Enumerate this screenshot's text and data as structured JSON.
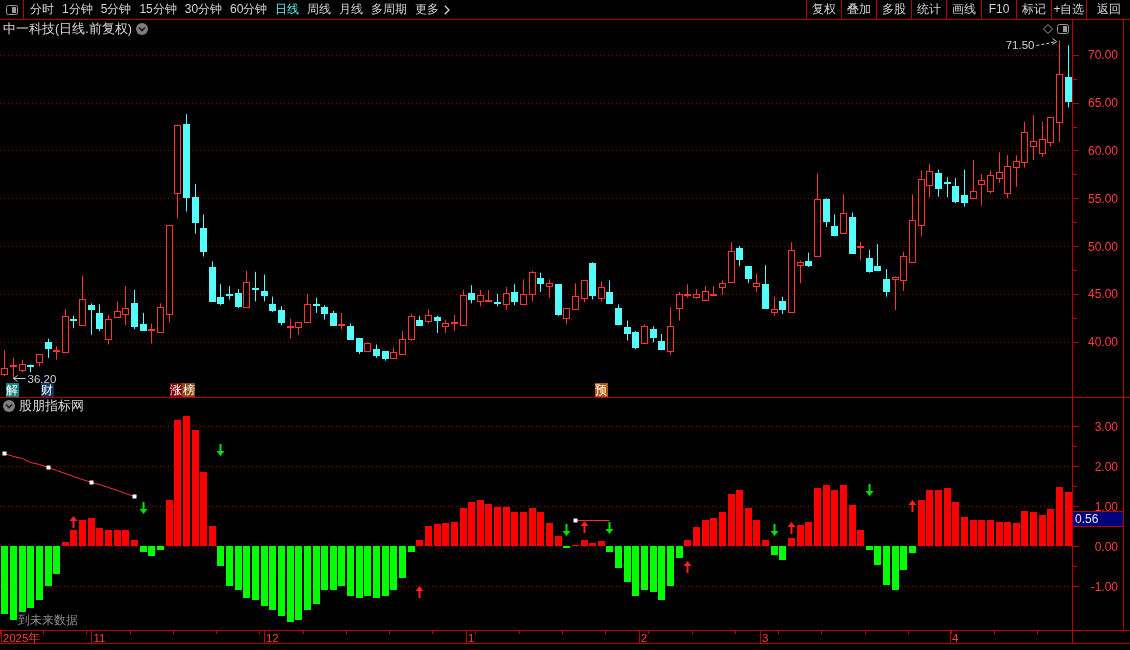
{
  "toolbar": {
    "periods": [
      {
        "label": "分时",
        "selected": false
      },
      {
        "label": "1分钟",
        "selected": false
      },
      {
        "label": "5分钟",
        "selected": false
      },
      {
        "label": "15分钟",
        "selected": false
      },
      {
        "label": "30分钟",
        "selected": false
      },
      {
        "label": "60分钟",
        "selected": false
      },
      {
        "label": "日线",
        "selected": true
      },
      {
        "label": "周线",
        "selected": false
      },
      {
        "label": "月线",
        "selected": false
      },
      {
        "label": "多周期",
        "selected": false
      }
    ],
    "more": "更多",
    "buttons": [
      "复权",
      "叠加",
      "多股",
      "统计",
      "画线",
      "F10",
      "标记",
      "+自选",
      "返回"
    ]
  },
  "main_chart": {
    "title": "中一科技(日线.前复权)",
    "chart_data": [
      {
        "type": "candlestick",
        "tick_labels": "y",
        "ylim": [
          34.2,
          73.65
        ],
        "yticks": [
          {
            "value": 70,
            "label": "70.00"
          },
          {
            "value": 65,
            "label": "65.00"
          },
          {
            "value": 60,
            "label": "60.00"
          },
          {
            "value": 55,
            "label": "55.00"
          },
          {
            "value": 50,
            "label": "50.00"
          },
          {
            "value": 45,
            "label": "45.00"
          },
          {
            "value": 40,
            "label": "40.00"
          }
        ],
        "grid": true,
        "ohlc": [
          [
            36.6,
            39.1,
            36.4,
            37.2
          ],
          [
            37.4,
            38.3,
            36.2,
            37.5
          ],
          [
            37.0,
            38.1,
            36.8,
            37.7
          ],
          [
            37.5,
            37.6,
            36.8,
            37.4
          ],
          [
            37.9,
            38.7,
            37.4,
            38.7
          ],
          [
            40.0,
            40.3,
            38.3,
            39.3
          ],
          [
            39.0,
            39.5,
            38.1,
            39.1
          ],
          [
            38.9,
            43.4,
            38.9,
            42.7
          ],
          [
            42.4,
            42.7,
            41.4,
            42.3
          ],
          [
            41.7,
            46.9,
            41.7,
            44.5
          ],
          [
            43.8,
            44.0,
            40.7,
            43.4
          ],
          [
            43.0,
            43.9,
            41.1,
            41.4
          ],
          [
            40.3,
            42.8,
            39.7,
            42.4
          ],
          [
            42.6,
            44.2,
            42.5,
            43.2
          ],
          [
            42.9,
            45.8,
            41.7,
            43.5
          ],
          [
            44.0,
            45.4,
            41.3,
            41.6
          ],
          [
            41.8,
            43.0,
            41.1,
            41.2
          ],
          [
            41.2,
            41.9,
            39.8,
            41.3
          ],
          [
            41.0,
            44.0,
            41.0,
            43.6
          ],
          [
            42.9,
            52.2,
            42.0,
            52.2
          ],
          [
            55.5,
            62.7,
            52.9,
            62.7
          ],
          [
            62.75,
            63.8,
            53.6,
            55.1
          ],
          [
            55.1,
            56.5,
            51.3,
            52.5
          ],
          [
            51.9,
            53.3,
            48.9,
            49.5
          ],
          [
            47.8,
            48.4,
            44.2,
            44.2
          ],
          [
            44.7,
            46.0,
            43.8,
            44.0
          ],
          [
            45.0,
            45.8,
            44.4,
            44.9
          ],
          [
            45.1,
            45.5,
            43.5,
            43.7
          ],
          [
            43.6,
            47.4,
            43.5,
            46.2
          ],
          [
            45.6,
            47.3,
            44.2,
            45.5
          ],
          [
            45.3,
            47.0,
            44.2,
            44.9
          ],
          [
            43.9,
            44.7,
            43.1,
            43.3
          ],
          [
            43.3,
            43.7,
            41.7,
            42.1
          ],
          [
            41.5,
            42.4,
            40.3,
            41.6
          ],
          [
            41.5,
            42.0,
            40.7,
            42.0
          ],
          [
            42.0,
            45.0,
            42.0,
            43.9
          ],
          [
            43.9,
            44.6,
            43.0,
            43.8
          ],
          [
            43.6,
            43.8,
            42.3,
            43.0
          ],
          [
            43.0,
            43.2,
            41.7,
            41.7
          ],
          [
            41.7,
            43.0,
            41.3,
            41.8
          ],
          [
            41.6,
            41.9,
            40.2,
            40.3
          ],
          [
            40.4,
            40.4,
            38.7,
            39.0
          ],
          [
            39.0,
            39.9,
            39.0,
            39.9
          ],
          [
            39.2,
            39.7,
            38.3,
            38.6
          ],
          [
            39.0,
            39.0,
            38.0,
            38.3
          ],
          [
            38.3,
            39.4,
            38.3,
            38.9
          ],
          [
            38.7,
            41.1,
            38.7,
            40.3
          ],
          [
            40.3,
            42.9,
            40.1,
            42.7
          ],
          [
            42.3,
            42.7,
            41.7,
            41.7
          ],
          [
            42.2,
            43.4,
            41.9,
            42.8
          ],
          [
            42.6,
            42.7,
            40.9,
            42.3
          ],
          [
            41.6,
            42.3,
            40.9,
            41.9
          ],
          [
            41.9,
            42.8,
            41.1,
            42.0
          ],
          [
            41.7,
            45.4,
            41.7,
            44.9
          ],
          [
            45.1,
            45.9,
            44.0,
            44.5
          ],
          [
            44.2,
            45.4,
            43.7,
            44.9
          ],
          [
            44.3,
            45.4,
            44.3,
            44.35
          ],
          [
            44.1,
            45.0,
            43.7,
            44.0
          ],
          [
            43.9,
            45.7,
            43.3,
            45.1
          ],
          [
            45.2,
            46.0,
            43.8,
            44.2
          ],
          [
            43.9,
            46.5,
            43.9,
            45.0
          ],
          [
            45.0,
            47.4,
            44.2,
            47.3
          ],
          [
            46.7,
            47.2,
            45.2,
            46.1
          ],
          [
            45.8,
            46.5,
            44.6,
            46.1
          ],
          [
            46.0,
            46.0,
            42.7,
            42.9
          ],
          [
            42.5,
            43.5,
            41.8,
            43.5
          ],
          [
            43.4,
            46.1,
            43.4,
            44.8
          ],
          [
            44.6,
            46.4,
            44.1,
            46.4
          ],
          [
            48.2,
            48.3,
            44.4,
            44.9
          ],
          [
            44.6,
            46.3,
            44.2,
            45.7
          ],
          [
            45.2,
            46.4,
            44.0,
            44.0
          ],
          [
            43.5,
            43.9,
            41.7,
            41.8
          ],
          [
            41.5,
            42.2,
            40.1,
            40.9
          ],
          [
            41.0,
            41.1,
            39.2,
            39.4
          ],
          [
            39.9,
            41.8,
            39.9,
            41.6
          ],
          [
            41.3,
            41.6,
            39.9,
            40.5
          ],
          [
            40.1,
            40.8,
            39.1,
            39.2
          ],
          [
            39.0,
            43.6,
            38.6,
            41.6
          ],
          [
            43.5,
            45.2,
            42.2,
            45.0
          ],
          [
            44.95,
            46.0,
            44.6,
            45.0
          ],
          [
            44.7,
            45.5,
            44.5,
            45.0
          ],
          [
            44.4,
            45.8,
            44.4,
            45.3
          ],
          [
            44.95,
            45.8,
            44.8,
            45.0
          ],
          [
            45.7,
            46.4,
            44.9,
            46.1
          ],
          [
            46.2,
            50.4,
            46.2,
            49.5
          ],
          [
            49.8,
            50.0,
            47.9,
            48.6
          ],
          [
            47.9,
            47.9,
            46.1,
            46.7
          ],
          [
            45.8,
            47.1,
            45.2,
            46.1
          ],
          [
            46.0,
            48.0,
            43.4,
            43.5
          ],
          [
            43.1,
            44.7,
            42.7,
            43.4
          ],
          [
            44.2,
            44.7,
            42.9,
            43.4
          ],
          [
            43.1,
            50.4,
            43.1,
            49.6
          ],
          [
            48.0,
            48.5,
            46.1,
            48.3
          ],
          [
            48.4,
            49.3,
            47.8,
            48.0
          ],
          [
            49.0,
            57.6,
            49.0,
            54.9
          ],
          [
            54.9,
            55.0,
            52.0,
            52.6
          ],
          [
            52.1,
            53.3,
            51.0,
            51.2
          ],
          [
            51.4,
            55.4,
            51.4,
            53.5
          ],
          [
            53.0,
            53.5,
            49.2,
            49.3
          ],
          [
            49.9,
            50.4,
            48.5,
            50.0
          ],
          [
            48.7,
            49.6,
            47.2,
            47.4
          ],
          [
            47.9,
            50.2,
            47.5,
            47.5
          ],
          [
            46.6,
            47.6,
            44.7,
            45.3
          ],
          [
            46.5,
            46.8,
            43.3,
            46.8
          ],
          [
            46.4,
            49.4,
            45.3,
            49.0
          ],
          [
            48.3,
            55.4,
            48.3,
            52.7
          ],
          [
            52.2,
            57.9,
            51.0,
            57.0
          ],
          [
            56.4,
            58.6,
            55.1,
            57.9
          ],
          [
            57.6,
            58.0,
            55.15,
            56.05
          ],
          [
            56.7,
            57.2,
            55.1,
            56.6
          ],
          [
            56.3,
            57.1,
            54.5,
            54.7
          ],
          [
            55.3,
            58.0,
            54.1,
            54.6
          ],
          [
            55.0,
            59.0,
            55.0,
            55.8
          ],
          [
            56.5,
            57.5,
            54.2,
            56.95
          ],
          [
            55.8,
            57.9,
            55.5,
            57.4
          ],
          [
            57.1,
            59.8,
            56.6,
            57.75
          ],
          [
            55.5,
            59.5,
            55.0,
            58.4
          ],
          [
            58.3,
            59.5,
            56.2,
            58.9
          ],
          [
            58.8,
            63.0,
            58.2,
            61.9
          ],
          [
            60.5,
            63.7,
            59.0,
            61.0
          ],
          [
            59.7,
            63.0,
            59.3,
            61.2
          ],
          [
            60.9,
            63.5,
            60.4,
            63.5
          ],
          [
            63.0,
            71.5,
            60.9,
            68.0
          ],
          [
            67.7,
            71.0,
            64.5,
            65.2
          ]
        ],
        "annotations": [
          "71.50",
          "36.20"
        ]
      }
    ],
    "event_tags": [
      {
        "label": "解",
        "color": "#148282"
      },
      {
        "label": "财",
        "color": "#0c3460"
      },
      {
        "label": "涨",
        "color": "#800a0a"
      },
      {
        "label": "榜",
        "color": "#8a4a14"
      },
      {
        "label": "预",
        "color": "#b05a10"
      }
    ]
  },
  "indicator_chart": {
    "title": "股朋指标网",
    "note": "到未来数据",
    "value_readout": "0.56",
    "chart_data": [
      {
        "type": "bar",
        "categories": [
          null,
          null,
          "2025年",
          null,
          null,
          null,
          null,
          null,
          null,
          null,
          null,
          "11",
          null,
          null,
          null,
          null,
          null,
          null,
          null,
          null,
          null,
          null,
          null,
          null,
          null,
          null,
          null,
          null,
          null,
          null,
          null,
          "12",
          null,
          null,
          null,
          null,
          null,
          null,
          null,
          null,
          null,
          null,
          null,
          null,
          null,
          null,
          null,
          null,
          null,
          null,
          null,
          null,
          null,
          null,
          "1",
          null,
          null,
          null,
          null,
          null,
          null,
          null,
          null,
          null,
          null,
          null,
          null,
          null,
          null,
          null,
          null,
          null,
          null,
          null,
          "2",
          null,
          null,
          null,
          null,
          null,
          null,
          null,
          null,
          null,
          null,
          null,
          null,
          null,
          "3",
          null,
          null,
          null,
          null,
          null,
          null,
          null,
          null,
          null,
          null,
          null,
          null,
          null,
          null,
          null,
          null,
          null,
          null,
          null,
          null,
          null,
          "4",
          null,
          null,
          null,
          null,
          null,
          null,
          null,
          null,
          null,
          null,
          null,
          null,
          null
        ],
        "ylim": [
          -2.1,
          3.725
        ],
        "yticks": [
          {
            "value": 3,
            "label": "3.00"
          },
          {
            "value": 2,
            "label": "2.00"
          },
          {
            "value": 1,
            "label": "1.00"
          },
          {
            "value": 0,
            "label": "0.00"
          },
          {
            "value": -1,
            "label": "-1.00"
          }
        ],
        "grid": true,
        "series": [
          {
            "type": "bar",
            "values": [
              -1.7,
              -1.85,
              -1.65,
              -1.55,
              -1.35,
              -1.0,
              -0.7,
              0.1,
              0.4,
              0.65,
              0.7,
              0.45,
              0.4,
              0.4,
              0.4,
              0.15,
              -0.15,
              -0.25,
              -0.1,
              1.15,
              3.15,
              3.25,
              2.9,
              1.85,
              0.5,
              -0.5,
              -1.0,
              -1.1,
              -1.3,
              -1.35,
              -1.5,
              -1.6,
              -1.75,
              -1.9,
              -1.85,
              -1.6,
              -1.45,
              -1.1,
              -1.1,
              -1.0,
              -1.25,
              -1.3,
              -1.25,
              -1.3,
              -1.25,
              -1.1,
              -0.8,
              -0.15,
              0.15,
              0.5,
              0.55,
              0.58,
              0.6,
              0.95,
              1.1,
              1.15,
              1.05,
              0.98,
              0.98,
              0.85,
              0.85,
              0.95,
              0.85,
              0.58,
              0.25,
              -0.05,
              0.03,
              0.15,
              0.08,
              0.12,
              -0.15,
              -0.55,
              -0.9,
              -1.25,
              -1.1,
              -1.15,
              -1.35,
              -1.0,
              -0.3,
              0.15,
              0.48,
              0.65,
              0.7,
              0.85,
              1.3,
              1.4,
              0.95,
              0.65,
              0.15,
              -0.22,
              -0.35,
              0.2,
              0.52,
              0.6,
              1.45,
              1.52,
              1.4,
              1.52,
              1.02,
              0.4,
              -0.1,
              -0.48,
              -0.98,
              -1.1,
              -0.6,
              -0.18,
              1.15,
              1.4,
              1.4,
              1.45,
              1.1,
              0.72,
              0.65,
              0.65,
              0.65,
              0.6,
              0.6,
              0.58,
              0.87,
              0.85,
              0.78,
              0.93,
              1.48,
              1.35
            ],
            "colors": [
              "#00ff00",
              "#00ff00",
              "#00ff00",
              "#00ff00",
              "#00ff00",
              "#00ff00",
              "#00ff00",
              "#ff0000",
              "#ff0000",
              "#ff0000",
              "#ff0000",
              "#ff0000",
              "#ff0000",
              "#ff0000",
              "#ff0000",
              "#ff0000",
              "#00ff00",
              "#00ff00",
              "#00ff00",
              "#ff0000",
              "#ff0000",
              "#ff0000",
              "#ff0000",
              "#ff0000",
              "#ff0000",
              "#00ff00",
              "#00ff00",
              "#00ff00",
              "#00ff00",
              "#00ff00",
              "#00ff00",
              "#00ff00",
              "#00ff00",
              "#00ff00",
              "#00ff00",
              "#00ff00",
              "#00ff00",
              "#00ff00",
              "#00ff00",
              "#00ff00",
              "#00ff00",
              "#00ff00",
              "#00ff00",
              "#00ff00",
              "#00ff00",
              "#00ff00",
              "#00ff00",
              "#00ff00",
              "#ff0000",
              "#ff0000",
              "#ff0000",
              "#ff0000",
              "#ff0000",
              "#ff0000",
              "#ff0000",
              "#ff0000",
              "#ff0000",
              "#ff0000",
              "#ff0000",
              "#ff0000",
              "#ff0000",
              "#ff0000",
              "#ff0000",
              "#ff0000",
              "#ff0000",
              "#00ff00",
              "#ff0000",
              "#ff0000",
              "#ff0000",
              "#ff0000",
              "#00ff00",
              "#00ff00",
              "#00ff00",
              "#00ff00",
              "#00ff00",
              "#00ff00",
              "#00ff00",
              "#00ff00",
              "#00ff00",
              "#ff0000",
              "#ff0000",
              "#ff0000",
              "#ff0000",
              "#ff0000",
              "#ff0000",
              "#ff0000",
              "#ff0000",
              "#ff0000",
              "#ff0000",
              "#00ff00",
              "#00ff00",
              "#ff0000",
              "#ff0000",
              "#ff0000",
              "#ff0000",
              "#ff0000",
              "#ff0000",
              "#ff0000",
              "#ff0000",
              "#ff0000",
              "#00ff00",
              "#00ff00",
              "#00ff00",
              "#00ff00",
              "#00ff00",
              "#00ff00",
              "#ff0000",
              "#ff0000",
              "#ff0000",
              "#ff0000",
              "#ff0000",
              "#ff0000",
              "#ff0000",
              "#ff0000",
              "#ff0000",
              "#ff0000",
              "#ff0000",
              "#ff0000",
              "#ff0000",
              "#ff0000",
              "#ff0000",
              "#ff0000",
              "#ff0000",
              "#ff0000"
            ]
          },
          {
            "type": "line",
            "color": "#ff3030",
            "values": [
              2.33,
              2.26,
              2.19,
              2.11,
              2.04,
              1.97,
              1.9,
              1.83,
              1.75,
              1.68,
              1.61,
              1.54,
              1.47,
              1.39,
              1.32,
              1.25,
              null,
              null,
              null,
              null,
              null,
              null,
              null,
              null,
              null,
              null,
              null,
              null,
              null,
              null,
              null,
              null,
              null,
              null,
              null,
              null,
              null,
              null,
              null,
              null,
              null,
              null,
              null,
              null,
              null,
              null,
              null,
              null,
              null,
              null,
              null,
              null,
              null,
              null,
              null,
              null,
              null,
              null,
              null,
              null,
              null,
              null,
              null,
              null,
              null,
              null,
              null,
              null,
              null,
              null,
              null,
              null,
              null,
              null,
              null,
              null,
              null,
              null,
              null,
              null,
              null,
              null,
              null,
              null,
              null,
              null,
              null,
              null,
              null,
              null,
              null,
              null,
              null,
              null,
              null,
              null,
              null,
              null,
              null,
              null,
              null,
              null,
              null,
              null,
              null,
              null,
              null,
              null,
              null,
              null,
              null,
              null,
              null,
              null,
              null,
              null,
              null,
              null,
              null,
              null,
              null,
              null,
              null,
              null
            ]
          },
          {
            "type": "line",
            "color": "#ff3030",
            "values": [
              null,
              null,
              null,
              null,
              null,
              null,
              null,
              null,
              null,
              null,
              null,
              null,
              null,
              null,
              null,
              null,
              null,
              null,
              null,
              null,
              null,
              null,
              null,
              null,
              null,
              null,
              null,
              null,
              null,
              null,
              null,
              null,
              null,
              null,
              null,
              null,
              null,
              null,
              null,
              null,
              null,
              null,
              null,
              null,
              null,
              null,
              null,
              null,
              null,
              null,
              null,
              null,
              null,
              null,
              null,
              null,
              null,
              null,
              null,
              null,
              null,
              null,
              null,
              null,
              null,
              null,
              0.66,
              0.66,
              0.66,
              0.66,
              0.66,
              null,
              null,
              null,
              null,
              null,
              null,
              null,
              null,
              null,
              null,
              null,
              null,
              null,
              null,
              null,
              null,
              null,
              null,
              null,
              null,
              null,
              null,
              null,
              null,
              null,
              null,
              null,
              null,
              null,
              null,
              null,
              null,
              null,
              null,
              null,
              null,
              null,
              null,
              null,
              null,
              null,
              null,
              null,
              null,
              null,
              null,
              null,
              null,
              null,
              null,
              null,
              null,
              null
            ]
          },
          {
            "type": "scatter",
            "marker": "square",
            "color": "#ffffff",
            "values": [
              2.33,
              null,
              null,
              null,
              null,
              1.97,
              null,
              null,
              null,
              null,
              1.61,
              null,
              null,
              null,
              null,
              1.25,
              null,
              null,
              null,
              null,
              null,
              null,
              null,
              null,
              null,
              null,
              null,
              null,
              null,
              null,
              null,
              null,
              null,
              null,
              null,
              null,
              null,
              null,
              null,
              null,
              null,
              null,
              null,
              null,
              null,
              null,
              null,
              null,
              null,
              null,
              null,
              null,
              null,
              null,
              null,
              null,
              null,
              null,
              null,
              null,
              null,
              null,
              null,
              null,
              null,
              null,
              0.66,
              null,
              null,
              null,
              null,
              null,
              null,
              null,
              null,
              null,
              null,
              null,
              null,
              null,
              null,
              null,
              null,
              null,
              null,
              null,
              null,
              null,
              null,
              null,
              null,
              null,
              null,
              null,
              null,
              null,
              null,
              null,
              null,
              null,
              null,
              null,
              null,
              null,
              null,
              null,
              null,
              null,
              null,
              null,
              null,
              null,
              null,
              null,
              null,
              null,
              null,
              null,
              null,
              null,
              null,
              null,
              null,
              null
            ]
          },
          {
            "type": "scatter",
            "color": "#ff2020",
            "values": [
              null,
              null,
              null,
              null,
              null,
              null,
              null,
              null,
              0.6,
              null,
              null,
              null,
              null,
              null,
              null,
              null,
              null,
              null,
              null,
              null,
              null,
              null,
              null,
              null,
              null,
              null,
              null,
              null,
              null,
              null,
              null,
              null,
              null,
              null,
              null,
              null,
              null,
              null,
              null,
              null,
              null,
              null,
              null,
              null,
              null,
              null,
              null,
              null,
              -1.15,
              null,
              null,
              null,
              null,
              null,
              null,
              null,
              null,
              null,
              null,
              null,
              null,
              null,
              null,
              null,
              null,
              null,
              null,
              0.48,
              null,
              null,
              null,
              null,
              null,
              null,
              null,
              null,
              null,
              null,
              null,
              -0.52,
              null,
              null,
              null,
              null,
              null,
              null,
              null,
              null,
              null,
              null,
              null,
              0.45,
              null,
              null,
              null,
              null,
              null,
              null,
              null,
              null,
              null,
              null,
              null,
              null,
              null,
              1.0,
              null,
              null,
              null,
              null,
              null,
              null,
              null,
              null,
              null,
              null,
              null,
              null,
              null,
              null,
              null,
              null,
              null,
              null
            ]
          },
          {
            "type": "scatter",
            "color": "#00e000",
            "values": [
              null,
              null,
              null,
              null,
              null,
              null,
              null,
              null,
              null,
              null,
              null,
              null,
              null,
              null,
              null,
              null,
              0.95,
              null,
              null,
              null,
              null,
              null,
              null,
              null,
              null,
              2.4,
              null,
              null,
              null,
              null,
              null,
              null,
              null,
              null,
              null,
              null,
              null,
              null,
              null,
              null,
              null,
              null,
              null,
              null,
              null,
              null,
              null,
              null,
              null,
              null,
              null,
              null,
              null,
              null,
              null,
              null,
              null,
              null,
              null,
              null,
              null,
              null,
              null,
              null,
              null,
              0.4,
              null,
              null,
              null,
              null,
              0.45,
              null,
              null,
              null,
              null,
              null,
              null,
              null,
              null,
              null,
              null,
              null,
              null,
              null,
              null,
              null,
              null,
              null,
              null,
              0.4,
              null,
              null,
              null,
              null,
              null,
              null,
              null,
              null,
              null,
              null,
              1.4,
              null,
              null,
              null,
              null,
              null,
              null,
              null,
              null,
              null,
              null,
              null,
              null,
              null,
              null,
              null,
              null,
              null,
              null,
              null,
              null,
              null,
              null,
              null
            ]
          }
        ]
      }
    ]
  }
}
